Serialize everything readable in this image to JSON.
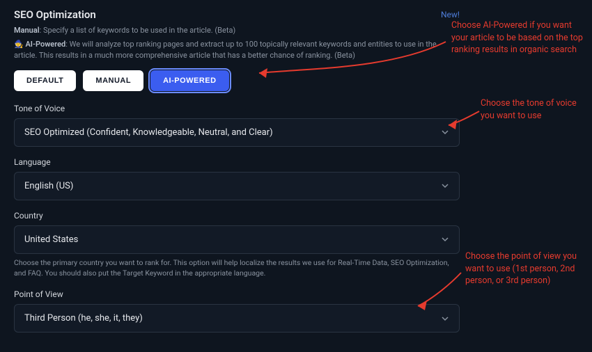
{
  "header": {
    "title": "SEO Optimization",
    "new_label": "New!"
  },
  "descriptions": {
    "manual_strong": "Manual",
    "manual_text": ": Specify a list of keywords to be used in the article. (Beta)",
    "ai_icon": "🧙",
    "ai_strong": "AI-Powered",
    "ai_text": ": We will analyze top ranking pages and extract up to 100 topically relevant keywords and entities to use in the article. This results in a much more comprehensive article that has a better chance of ranking. (Beta)"
  },
  "buttons": {
    "default": "DEFAULT",
    "manual": "MANUAL",
    "ai": "AI-POWERED"
  },
  "fields": {
    "tone": {
      "label": "Tone of Voice",
      "value": "SEO Optimized (Confident, Knowledgeable, Neutral, and Clear)"
    },
    "language": {
      "label": "Language",
      "value": "English (US)"
    },
    "country": {
      "label": "Country",
      "value": "United States",
      "helper": "Choose the primary country you want to rank for. This option will help localize the results we use for Real-Time Data, SEO Optimization, and FAQ. You should also put the Target Keyword in the appropriate language."
    },
    "pov": {
      "label": "Point of View",
      "value": "Third Person (he, she, it, they)"
    }
  },
  "annotations": {
    "ai": "Choose AI-Powered if you want your article to be based on the top ranking results in organic search",
    "tone": "Choose the tone of voice you want to use",
    "pov": "Choose the point of view you want to use (1st person, 2nd person, or 3rd person)"
  }
}
